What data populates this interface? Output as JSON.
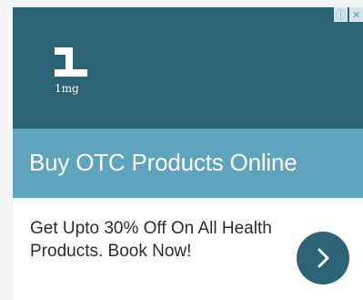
{
  "brand": {
    "logo_mark": "1",
    "logo_text": "1mg"
  },
  "adchoices": {
    "info_icon": "info-icon",
    "close_icon": "close-icon"
  },
  "headline": "Buy OTC Products Online",
  "description": "Get Upto 30% Off On All Health Products. Book Now!",
  "cta": {
    "icon": "chevron-right-icon"
  },
  "colors": {
    "hero": "#2d6475",
    "band": "#5ea4be",
    "cta": "#2d6475"
  }
}
